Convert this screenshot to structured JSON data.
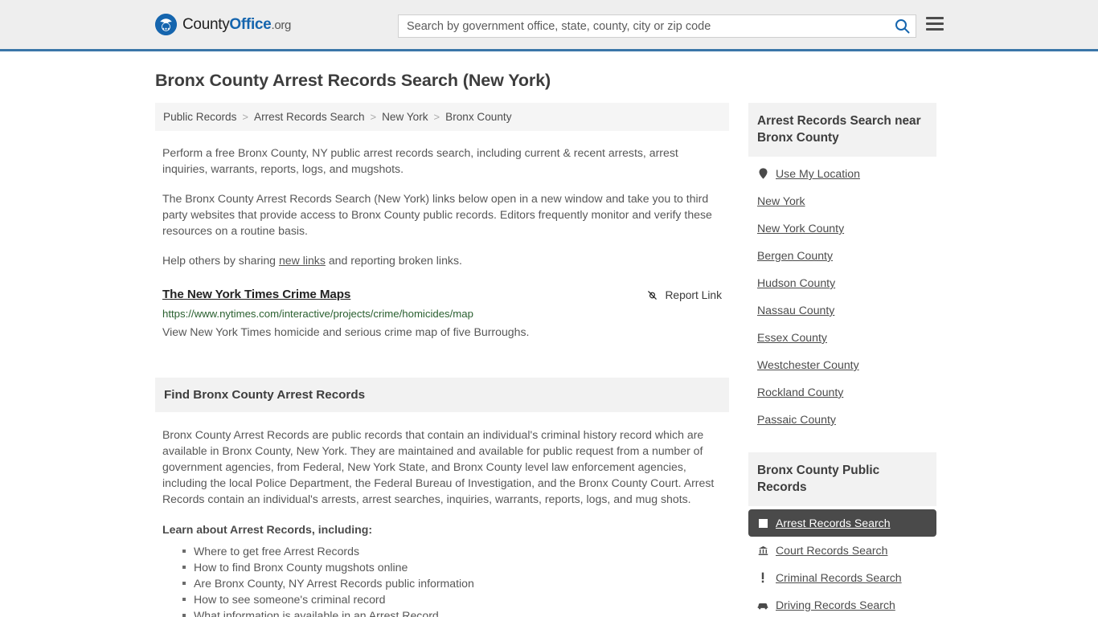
{
  "header": {
    "brand": {
      "part1": "County",
      "part2": "Office",
      "part3": ".org"
    },
    "search": {
      "placeholder": "Search by government office, state, county, city or zip code",
      "value": "",
      "icon": "search-icon"
    },
    "menu_icon": "hamburger-menu-icon",
    "accent_color": "#3a76a8"
  },
  "page": {
    "title": "Bronx County Arrest Records Search (New York)"
  },
  "breadcrumb": {
    "items": [
      "Public Records",
      "Arrest Records Search",
      "New York",
      "Bronx County"
    ],
    "separator": ">"
  },
  "intro": {
    "p1": "Perform a free Bronx County, NY public arrest records search, including current & recent arrests, arrest inquiries, warrants, reports, logs, and mugshots.",
    "p2": "The Bronx County Arrest Records Search (New York) links below open in a new window and take you to third party websites that provide access to Bronx County public records. Editors frequently monitor and verify these resources on a routine basis.",
    "p3_before": "Help others by sharing ",
    "p3_link": "new links",
    "p3_after": " and reporting broken links."
  },
  "result": {
    "title": "The New York Times Crime Maps",
    "url": "https://www.nytimes.com/interactive/projects/crime/homicides/map",
    "description": "View New York Times homicide and serious crime map of five Burroughs.",
    "report_label": "Report Link",
    "report_icon": "broken-link-icon",
    "url_color": "#2a6030"
  },
  "find_section": {
    "heading": "Find Bronx County Arrest Records",
    "body": "Bronx County Arrest Records are public records that contain an individual's criminal history record which are available in Bronx County, New York. They are maintained and available for public request from a number of government agencies, from Federal, New York State, and Bronx County level law enforcement agencies, including the local Police Department, the Federal Bureau of Investigation, and the Bronx County Court. Arrest Records contain an individual's arrests, arrest searches, inquiries, warrants, reports, logs, and mug shots.",
    "subhead": "Learn about Arrest Records, including:",
    "bullets": [
      "Where to get free Arrest Records",
      "How to find Bronx County mugshots online",
      "Are Bronx County, NY Arrest Records public information",
      "How to see someone's criminal record",
      "What information is available in an Arrest Record"
    ]
  },
  "sidebar": {
    "nearby": {
      "heading": "Arrest Records Search near Bronx County",
      "items": [
        {
          "label": "Use My Location",
          "icon": "map-pin-icon"
        },
        {
          "label": "New York",
          "icon": ""
        },
        {
          "label": "New York County",
          "icon": ""
        },
        {
          "label": "Bergen County",
          "icon": ""
        },
        {
          "label": "Hudson County",
          "icon": ""
        },
        {
          "label": "Nassau County",
          "icon": ""
        },
        {
          "label": "Essex County",
          "icon": ""
        },
        {
          "label": "Westchester County",
          "icon": ""
        },
        {
          "label": "Rockland County",
          "icon": ""
        },
        {
          "label": "Passaic County",
          "icon": ""
        }
      ]
    },
    "public_records": {
      "heading": "Bronx County Public Records",
      "active_color": "#4a4a4a",
      "items": [
        {
          "label": "Arrest Records Search",
          "icon": "white-square-icon",
          "active": true
        },
        {
          "label": "Court Records Search",
          "icon": "bank-icon",
          "active": false
        },
        {
          "label": "Criminal Records Search",
          "icon": "exclamation-icon",
          "active": false
        },
        {
          "label": "Driving Records Search",
          "icon": "car-icon",
          "active": false
        }
      ]
    }
  }
}
